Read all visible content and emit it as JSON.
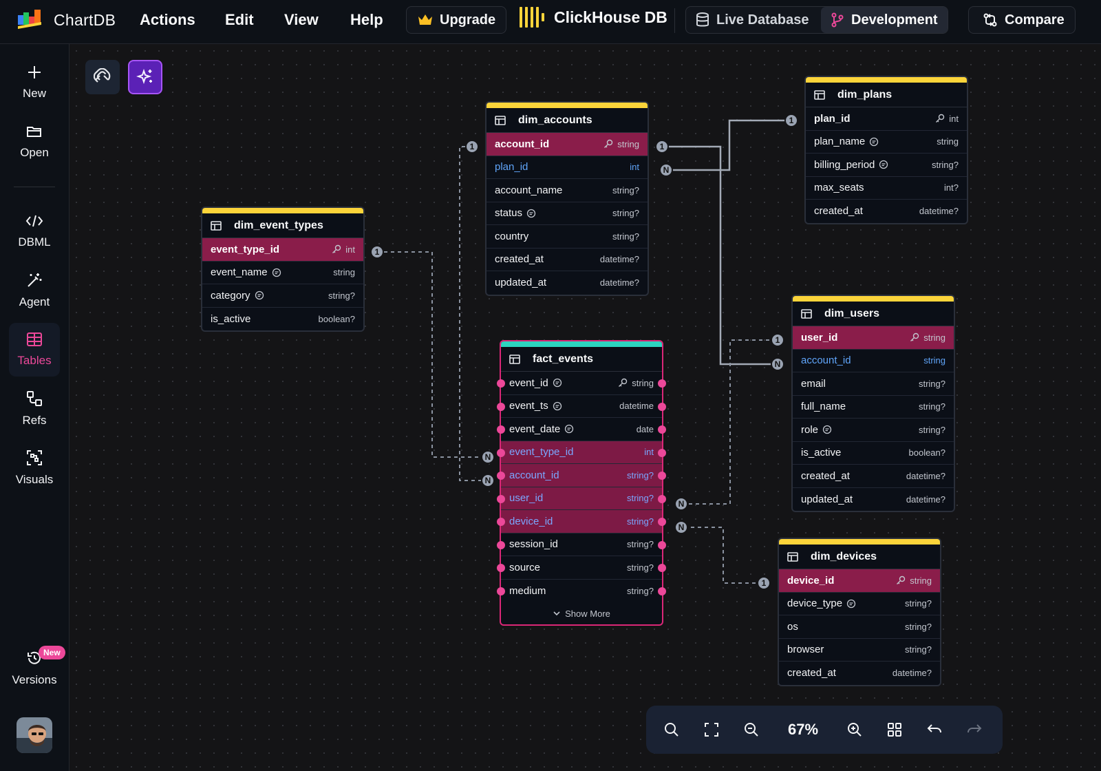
{
  "app": {
    "name": "ChartDB"
  },
  "menu": [
    "Actions",
    "Edit",
    "View",
    "Help"
  ],
  "upgrade_label": "Upgrade",
  "database_name": "ClickHouse DB",
  "env": {
    "live": "Live Database",
    "dev": "Development",
    "active": "Development"
  },
  "compare_label": "Compare",
  "sidebar": [
    {
      "label": "New",
      "icon": "plus-icon"
    },
    {
      "label": "Open",
      "icon": "folder-icon"
    },
    {
      "label": "DBML",
      "icon": "code-icon"
    },
    {
      "label": "Agent",
      "icon": "magic-wand-icon"
    },
    {
      "label": "Tables",
      "icon": "table-icon",
      "active": true
    },
    {
      "label": "Refs",
      "icon": "refs-icon"
    },
    {
      "label": "Visuals",
      "icon": "visuals-icon"
    },
    {
      "label": "Versions",
      "icon": "history-icon",
      "badge": "New"
    }
  ],
  "tables": {
    "dim_accounts": {
      "name": "dim_accounts",
      "rows": [
        {
          "name": "account_id",
          "type": "string",
          "pk": true
        },
        {
          "name": "plan_id",
          "type": "int",
          "fk": true
        },
        {
          "name": "account_name",
          "type": "string?"
        },
        {
          "name": "status",
          "type": "string?",
          "comment": true
        },
        {
          "name": "country",
          "type": "string?"
        },
        {
          "name": "created_at",
          "type": "datetime?"
        },
        {
          "name": "updated_at",
          "type": "datetime?"
        }
      ]
    },
    "dim_plans": {
      "name": "dim_plans",
      "rows": [
        {
          "name": "plan_id",
          "type": "int",
          "pk": true,
          "plain": true
        },
        {
          "name": "plan_name",
          "type": "string",
          "comment": true
        },
        {
          "name": "billing_period",
          "type": "string?",
          "comment": true
        },
        {
          "name": "max_seats",
          "type": "int?"
        },
        {
          "name": "created_at",
          "type": "datetime?"
        }
      ]
    },
    "dim_event_types": {
      "name": "dim_event_types",
      "rows": [
        {
          "name": "event_type_id",
          "type": "int",
          "pk": true
        },
        {
          "name": "event_name",
          "type": "string",
          "comment": true
        },
        {
          "name": "category",
          "type": "string?",
          "comment": true
        },
        {
          "name": "is_active",
          "type": "boolean?"
        }
      ]
    },
    "fact_events": {
      "name": "fact_events",
      "rows": [
        {
          "name": "event_id",
          "type": "string",
          "comment": true,
          "key": true
        },
        {
          "name": "event_ts",
          "type": "datetime",
          "comment": true
        },
        {
          "name": "event_date",
          "type": "date",
          "comment": true
        },
        {
          "name": "event_type_id",
          "type": "int",
          "sel": true
        },
        {
          "name": "account_id",
          "type": "string?",
          "sel": true
        },
        {
          "name": "user_id",
          "type": "string?",
          "sel": true
        },
        {
          "name": "device_id",
          "type": "string?",
          "sel": true
        },
        {
          "name": "session_id",
          "type": "string?"
        },
        {
          "name": "source",
          "type": "string?"
        },
        {
          "name": "medium",
          "type": "string?"
        }
      ],
      "show_more": "Show More"
    },
    "dim_users": {
      "name": "dim_users",
      "rows": [
        {
          "name": "user_id",
          "type": "string",
          "pk": true
        },
        {
          "name": "account_id",
          "type": "string",
          "fk": true
        },
        {
          "name": "email",
          "type": "string?"
        },
        {
          "name": "full_name",
          "type": "string?"
        },
        {
          "name": "role",
          "type": "string?",
          "comment": true
        },
        {
          "name": "is_active",
          "type": "boolean?"
        },
        {
          "name": "created_at",
          "type": "datetime?"
        },
        {
          "name": "updated_at",
          "type": "datetime?"
        }
      ]
    },
    "dim_devices": {
      "name": "dim_devices",
      "rows": [
        {
          "name": "device_id",
          "type": "string",
          "pk": true
        },
        {
          "name": "device_type",
          "type": "string?",
          "comment": true
        },
        {
          "name": "os",
          "type": "string?"
        },
        {
          "name": "browser",
          "type": "string?"
        },
        {
          "name": "created_at",
          "type": "datetime?"
        }
      ]
    }
  },
  "cardinality": {
    "one": "1",
    "many": "N"
  },
  "zoom": {
    "value": "67%"
  },
  "colors": {
    "accent": "#ec4899",
    "pk_row": "#8a1d4a",
    "fk_text": "#60a5fa",
    "header_stripe": "#fbd43a",
    "fact_stripe": "#2dd4bf"
  }
}
